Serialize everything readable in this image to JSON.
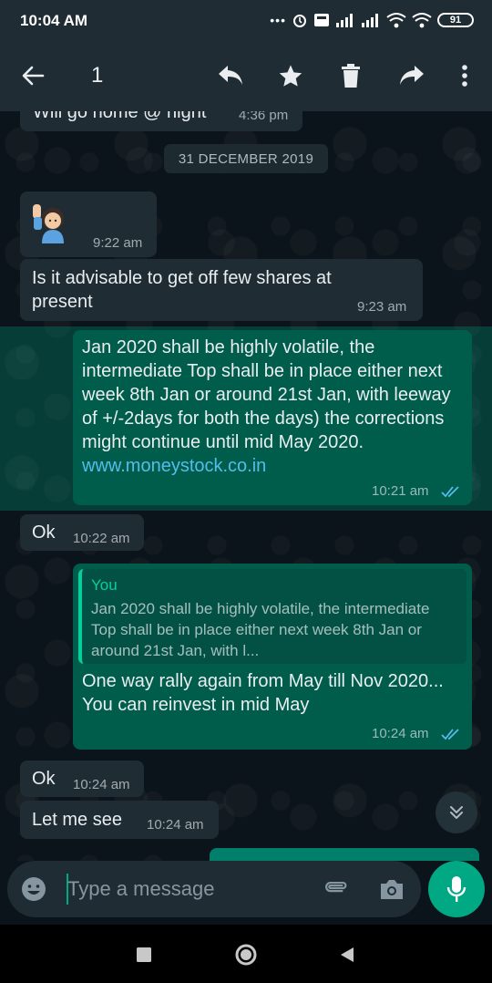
{
  "status_bar": {
    "time": "10:04 AM",
    "more": "•••",
    "battery": "91"
  },
  "toolbar": {
    "selected_count": "1"
  },
  "messages": {
    "prev_text": "Will go home @ night",
    "prev_time": "4:36 pm",
    "date_divider": "31 DECEMBER 2019",
    "emoji_time": "9:22 am",
    "m1_text": "Is it advisable to get off few shares at present",
    "m1_time": "9:23 am",
    "m2_text": "Jan 2020 shall be highly volatile, the intermediate Top shall be in place either next week 8th Jan or around 21st Jan, with leeway of +/-2days for both the days) the corrections might continue until mid May 2020.",
    "m2_link": "www.moneystock.co.in",
    "m2_time": "10:21 am",
    "m3_text": "Ok",
    "m3_time": "10:22 am",
    "m4_quote_author": "You",
    "m4_quote_text": "Jan 2020 shall be highly volatile, the intermediate Top shall be in place either next week 8th Jan or around 21st Jan, with l...",
    "m4_text": "One way rally again from May till Nov 2020... You can reinvest in mid May",
    "m4_time": "10:24 am",
    "m5_text": "Ok",
    "m5_time": "10:24 am",
    "m6_text": "Let me see",
    "m6_time": "10:24 am"
  },
  "input": {
    "placeholder": "Type a message"
  },
  "colors": {
    "accent": "#00a884",
    "outgoing": "#005c4b",
    "incoming": "#1f2c33",
    "link": "#53bdeb",
    "read_tick": "#53bdeb"
  },
  "icons": {
    "toolbar": [
      "back-arrow-icon",
      "reply-icon",
      "star-icon",
      "delete-icon",
      "forward-icon",
      "more-vert-icon"
    ],
    "input": [
      "emoji-icon",
      "attach-icon",
      "camera-icon",
      "mic-icon"
    ],
    "nav": [
      "recents-square-icon",
      "home-circle-icon",
      "back-triangle-icon"
    ]
  }
}
